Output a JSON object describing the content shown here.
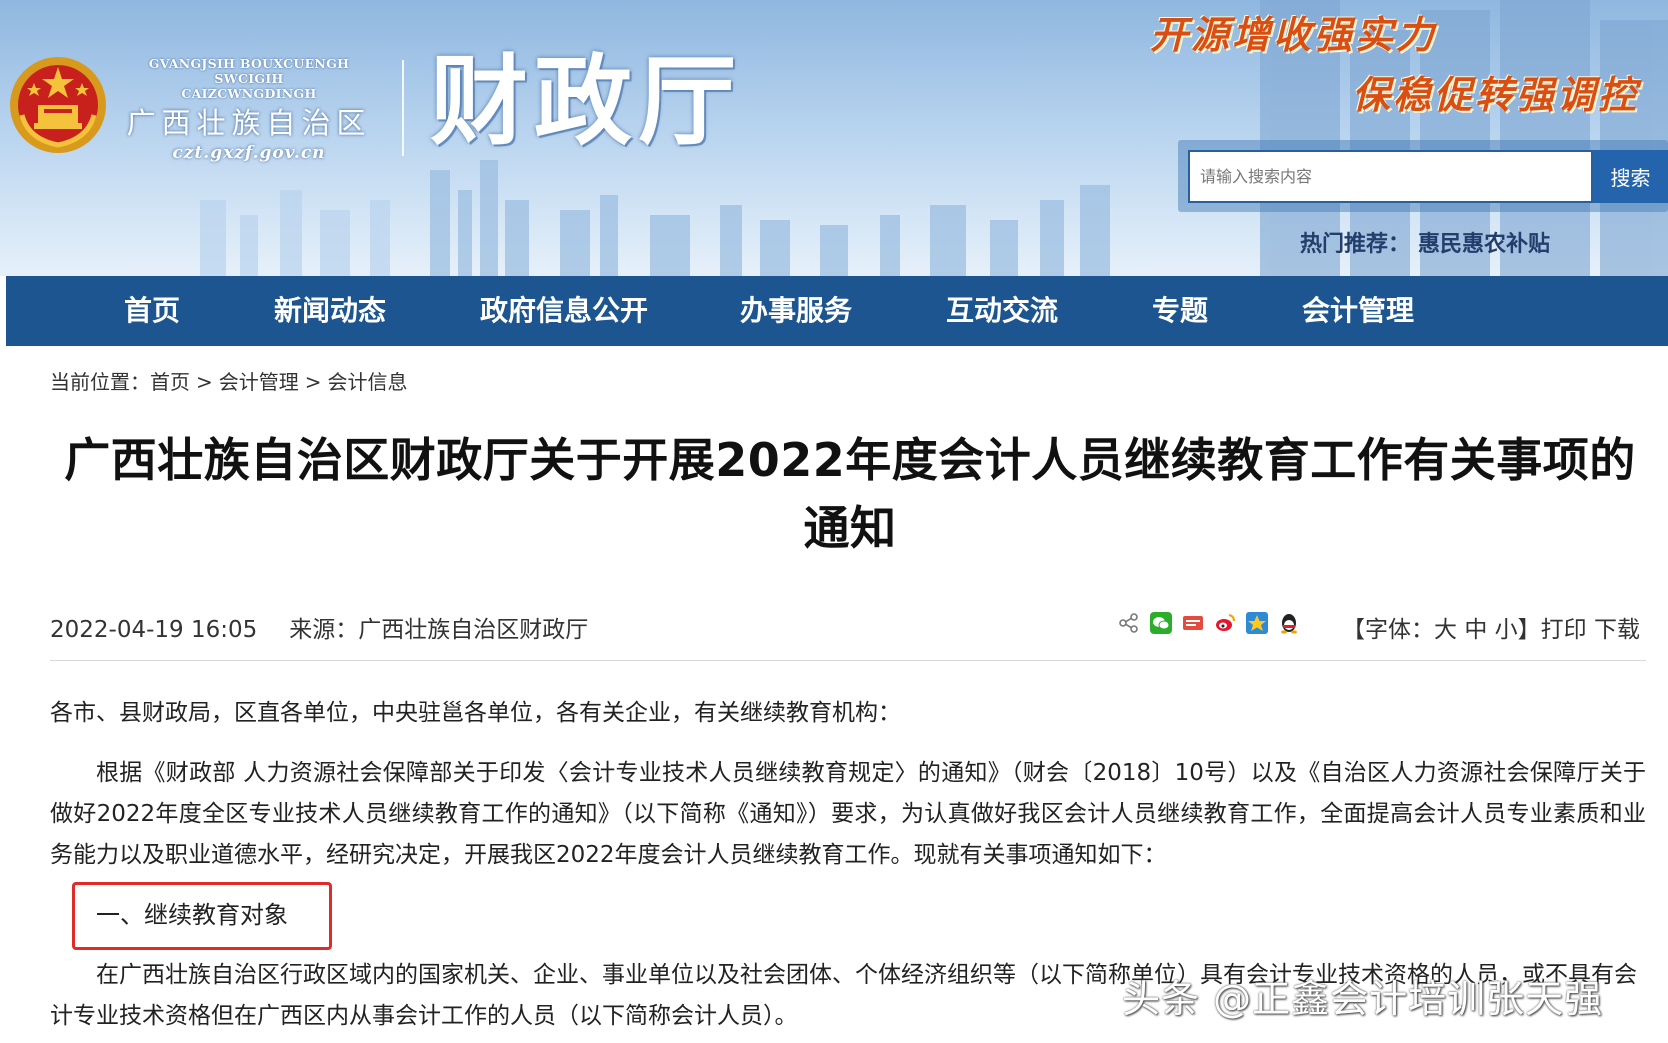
{
  "header": {
    "logo": {
      "line1": "GVANGJSIH BOUXCUENGH SWCIGIH",
      "line2": "CAIZCWNGDINGH",
      "region_name": "广西壮族自治区",
      "url": "czt.gxzf.gov.cn"
    },
    "dept_name": "财政厅",
    "slogan1": "开源增收强实力",
    "slogan2": "保稳促转强调控",
    "search": {
      "placeholder": "请输入搜索内容",
      "button_label": "搜索"
    },
    "hot": {
      "label": "热门推荐：",
      "link": "惠民惠农补贴"
    }
  },
  "nav": {
    "items": [
      {
        "label": "首页"
      },
      {
        "label": "新闻动态"
      },
      {
        "label": "政府信息公开"
      },
      {
        "label": "办事服务"
      },
      {
        "label": "互动交流"
      },
      {
        "label": "专题"
      },
      {
        "label": "会计管理"
      }
    ]
  },
  "breadcrumb": {
    "prefix": "当前位置：",
    "items": [
      "首页",
      "会计管理",
      "会计信息"
    ],
    "separator": ">"
  },
  "article": {
    "title_line1": "广西壮族自治区财政厅关于开展2022年度会计人员继续教育工作有关事项的",
    "title_line2": "通知",
    "date": "2022-04-19 16:05",
    "source": "来源：广西壮族自治区财政厅",
    "share_icons": [
      "share-icon",
      "wechat-icon",
      "tencent-weibo-icon",
      "weibo-icon",
      "qzone-icon",
      "qq-icon"
    ],
    "font_control": {
      "bracket_open": "【字体：",
      "large": "大",
      "medium": "中",
      "small": "小",
      "bracket_close": "】",
      "print": "打印",
      "download": "下载"
    },
    "salutation": "各市、县财政局，区直各单位，中央驻邕各单位，各有关企业，有关继续教育机构：",
    "paragraph1": "根据《财政部 人力资源社会保障部关于印发〈会计专业技术人员继续教育规定〉的通知》（财会〔2018〕10号）以及《自治区人力资源社会保障厅关于做好2022年度全区专业技术人员继续教育工作的通知》（以下简称《通知》）要求，为认真做好我区会计人员继续教育工作，全面提高会计人员专业素质和业务能力以及职业道德水平，经研究决定，开展我区2022年度会计人员继续教育工作。现就有关事项通知如下：",
    "section1_heading": "一、继续教育对象",
    "section1_text": "在广西壮族自治区行政区域内的国家机关、企业、事业单位以及社会团体、个体经济组织等（以下简称单位）具有会计专业技术资格的人员，或不具有会计专业技术资格但在广西区内从事会计工作的人员（以下简称会计人员）。"
  },
  "watermark": "头条 @正鑫会计培训张天强",
  "colors": {
    "nav_bg": "#1c5590",
    "search_btn": "#2464ac",
    "highlight_border": "#e02b2b",
    "slogan": "#d94e12"
  }
}
